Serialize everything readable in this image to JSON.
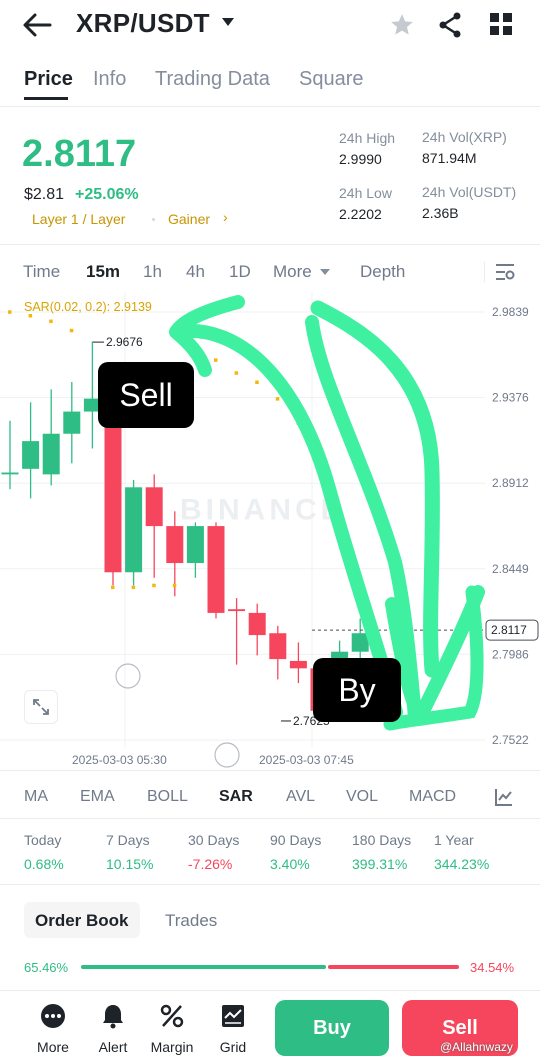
{
  "header": {
    "title": "XRP/USDT",
    "back_icon": "arrow-left-icon",
    "icons": [
      "star-icon",
      "share-icon",
      "grid-icon"
    ]
  },
  "tabs": [
    "Price",
    "Info",
    "Trading Data",
    "Square"
  ],
  "ticker": {
    "price": "2.8117",
    "usd_price": "$2.81",
    "change": "+25.06%",
    "tag1": "Layer 1 / Layer",
    "tag2": "Gainer",
    "high_label": "24h High",
    "high_value": "2.9990",
    "low_label": "24h Low",
    "low_value": "2.2202",
    "vol_xrp_label": "24h Vol(XRP)",
    "vol_xrp_value": "871.94M",
    "vol_usdt_label": "24h Vol(USDT)",
    "vol_usdt_value": "2.36B"
  },
  "timeframes": [
    "Time",
    "15m",
    "1h",
    "4h",
    "1D",
    "More",
    "Depth"
  ],
  "chart_data": {
    "type": "candlestick",
    "indicator_label": "SAR(0.02, 0.2): 2.9139",
    "y_ticks": [
      "2.9839",
      "2.9376",
      "2.8912",
      "2.8449",
      "2.7986",
      "2.7522"
    ],
    "current_price": "2.8117",
    "high_marker": "2.9676",
    "low_marker": "2.7625",
    "x_labels": [
      "2025-03-03 05:30",
      "2025-03-03 07:45"
    ],
    "watermark": "BINANCE",
    "candles": [
      {
        "o": 2.896,
        "h": 2.925,
        "l": 2.888,
        "c": 2.897
      },
      {
        "o": 2.899,
        "h": 2.935,
        "l": 2.883,
        "c": 2.914
      },
      {
        "o": 2.896,
        "h": 2.942,
        "l": 2.89,
        "c": 2.918
      },
      {
        "o": 2.918,
        "h": 2.946,
        "l": 2.902,
        "c": 2.93
      },
      {
        "o": 2.93,
        "h": 2.968,
        "l": 2.91,
        "c": 2.937
      },
      {
        "o": 2.937,
        "h": 2.945,
        "l": 2.836,
        "c": 2.843
      },
      {
        "o": 2.843,
        "h": 2.893,
        "l": 2.836,
        "c": 2.889
      },
      {
        "o": 2.889,
        "h": 2.896,
        "l": 2.84,
        "c": 2.868
      },
      {
        "o": 2.868,
        "h": 2.876,
        "l": 2.83,
        "c": 2.848
      },
      {
        "o": 2.848,
        "h": 2.87,
        "l": 2.84,
        "c": 2.868
      },
      {
        "o": 2.868,
        "h": 2.87,
        "l": 2.818,
        "c": 2.821
      },
      {
        "o": 2.823,
        "h": 2.829,
        "l": 2.793,
        "c": 2.822
      },
      {
        "o": 2.821,
        "h": 2.826,
        "l": 2.798,
        "c": 2.809
      },
      {
        "o": 2.81,
        "h": 2.814,
        "l": 2.785,
        "c": 2.796
      },
      {
        "o": 2.795,
        "h": 2.805,
        "l": 2.783,
        "c": 2.791
      },
      {
        "o": 2.791,
        "h": 2.794,
        "l": 2.762,
        "c": 2.768
      },
      {
        "o": 2.768,
        "h": 2.806,
        "l": 2.765,
        "c": 2.8
      },
      {
        "o": 2.8,
        "h": 2.818,
        "l": 2.791,
        "c": 2.81
      }
    ],
    "sar": [
      {
        "i": 0,
        "v": 2.984
      },
      {
        "i": 1,
        "v": 2.982
      },
      {
        "i": 2,
        "v": 2.979
      },
      {
        "i": 3,
        "v": 2.974
      },
      {
        "i": 5,
        "v": 2.835
      },
      {
        "i": 6,
        "v": 2.835
      },
      {
        "i": 7,
        "v": 2.836
      },
      {
        "i": 8,
        "v": 2.836
      },
      {
        "i": 9,
        "v": 2.964
      },
      {
        "i": 10,
        "v": 2.958
      },
      {
        "i": 11,
        "v": 2.951
      },
      {
        "i": 12,
        "v": 2.946
      },
      {
        "i": 13,
        "v": 2.937
      },
      {
        "i": 14,
        "v": 2.924
      },
      {
        "i": 15,
        "v": 2.913
      }
    ]
  },
  "annotations": {
    "sell": "Sell",
    "buy": "By"
  },
  "indicators": [
    "MA",
    "EMA",
    "BOLL",
    "SAR",
    "AVL",
    "VOL",
    "MACD"
  ],
  "performance": [
    {
      "label": "Today",
      "value": "0.68%",
      "dir": "up"
    },
    {
      "label": "7 Days",
      "value": "10.15%",
      "dir": "up"
    },
    {
      "label": "30 Days",
      "value": "-7.26%",
      "dir": "down"
    },
    {
      "label": "90 Days",
      "value": "3.40%",
      "dir": "up"
    },
    {
      "label": "180 Days",
      "value": "399.31%",
      "dir": "up"
    },
    {
      "label": "1 Year",
      "value": "344.23%",
      "dir": "up"
    }
  ],
  "orderbook_tabs": [
    "Order Book",
    "Trades"
  ],
  "ratio": {
    "buy": "65.46%",
    "sell": "34.54%",
    "buy_fraction": 0.6546
  },
  "bottom_bar": {
    "items": [
      {
        "label": "More",
        "icon": "more-icon"
      },
      {
        "label": "Alert",
        "icon": "bell-icon"
      },
      {
        "label": "Margin",
        "icon": "percent-icon"
      },
      {
        "label": "Grid",
        "icon": "grid-bot-icon"
      }
    ],
    "buy": "Buy",
    "sell": "Sell"
  },
  "watermark_user": "@Allahnwazy",
  "colors": {
    "up": "#2ebd85",
    "down": "#f6465d",
    "sar": "#f0b90b",
    "brand_text": "#c99400",
    "scribble": "#3ef0a0"
  }
}
